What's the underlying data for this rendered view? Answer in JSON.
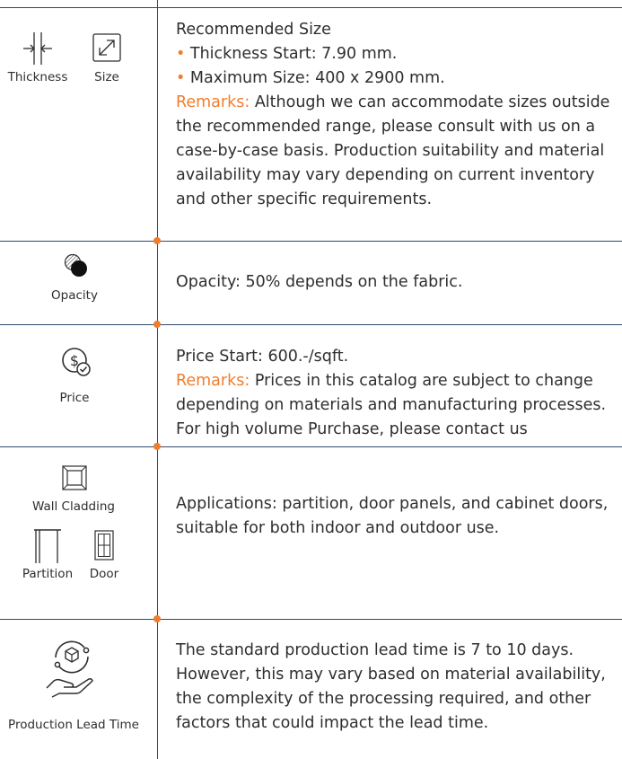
{
  "accent_color": "#f07d2d",
  "line_color": "#2f4b6b",
  "rows": [
    {
      "icons": [
        {
          "name": "thickness-icon",
          "label": "Thickness"
        },
        {
          "name": "size-icon",
          "label": "Size"
        }
      ],
      "title": "Recommended Size",
      "bullets": [
        "Thickness  Start: 7.90 mm.",
        "Maximum Size: 400 x 2900 mm."
      ],
      "remarks_label": "Remarks:",
      "remarks_text": " Although we can accommodate sizes outside the recommended range, please consult with us on a case-by-case basis. Production suitability and material availability may vary depending on current inventory and other specific requirements."
    },
    {
      "icons": [
        {
          "name": "opacity-icon",
          "label": "Opacity"
        }
      ],
      "text": "Opacity: 50% depends on the fabric."
    },
    {
      "icons": [
        {
          "name": "price-icon",
          "label": "Price"
        }
      ],
      "title": "Price Start:  600.-/sqft.",
      "remarks_label": "Remarks:",
      "remarks_text": " Prices in this catalog are subject to change depending on materials and manufacturing processes. For high volume Purchase, please contact us"
    },
    {
      "icons": [
        {
          "name": "wall-cladding-icon",
          "label": "Wall Cladding"
        },
        {
          "name": "partition-icon",
          "label": "Partition"
        },
        {
          "name": "door-icon",
          "label": "Door"
        }
      ],
      "text": "Applications: partition, door panels, and cabinet doors, suitable for both indoor and outdoor use."
    },
    {
      "icons": [
        {
          "name": "production-lead-time-icon",
          "label": "Production Lead Time"
        }
      ],
      "text": "The standard production lead time is 7 to 10 days. However, this may vary based on material availability, the complexity of the processing required, and other factors that could impact the lead time."
    }
  ]
}
